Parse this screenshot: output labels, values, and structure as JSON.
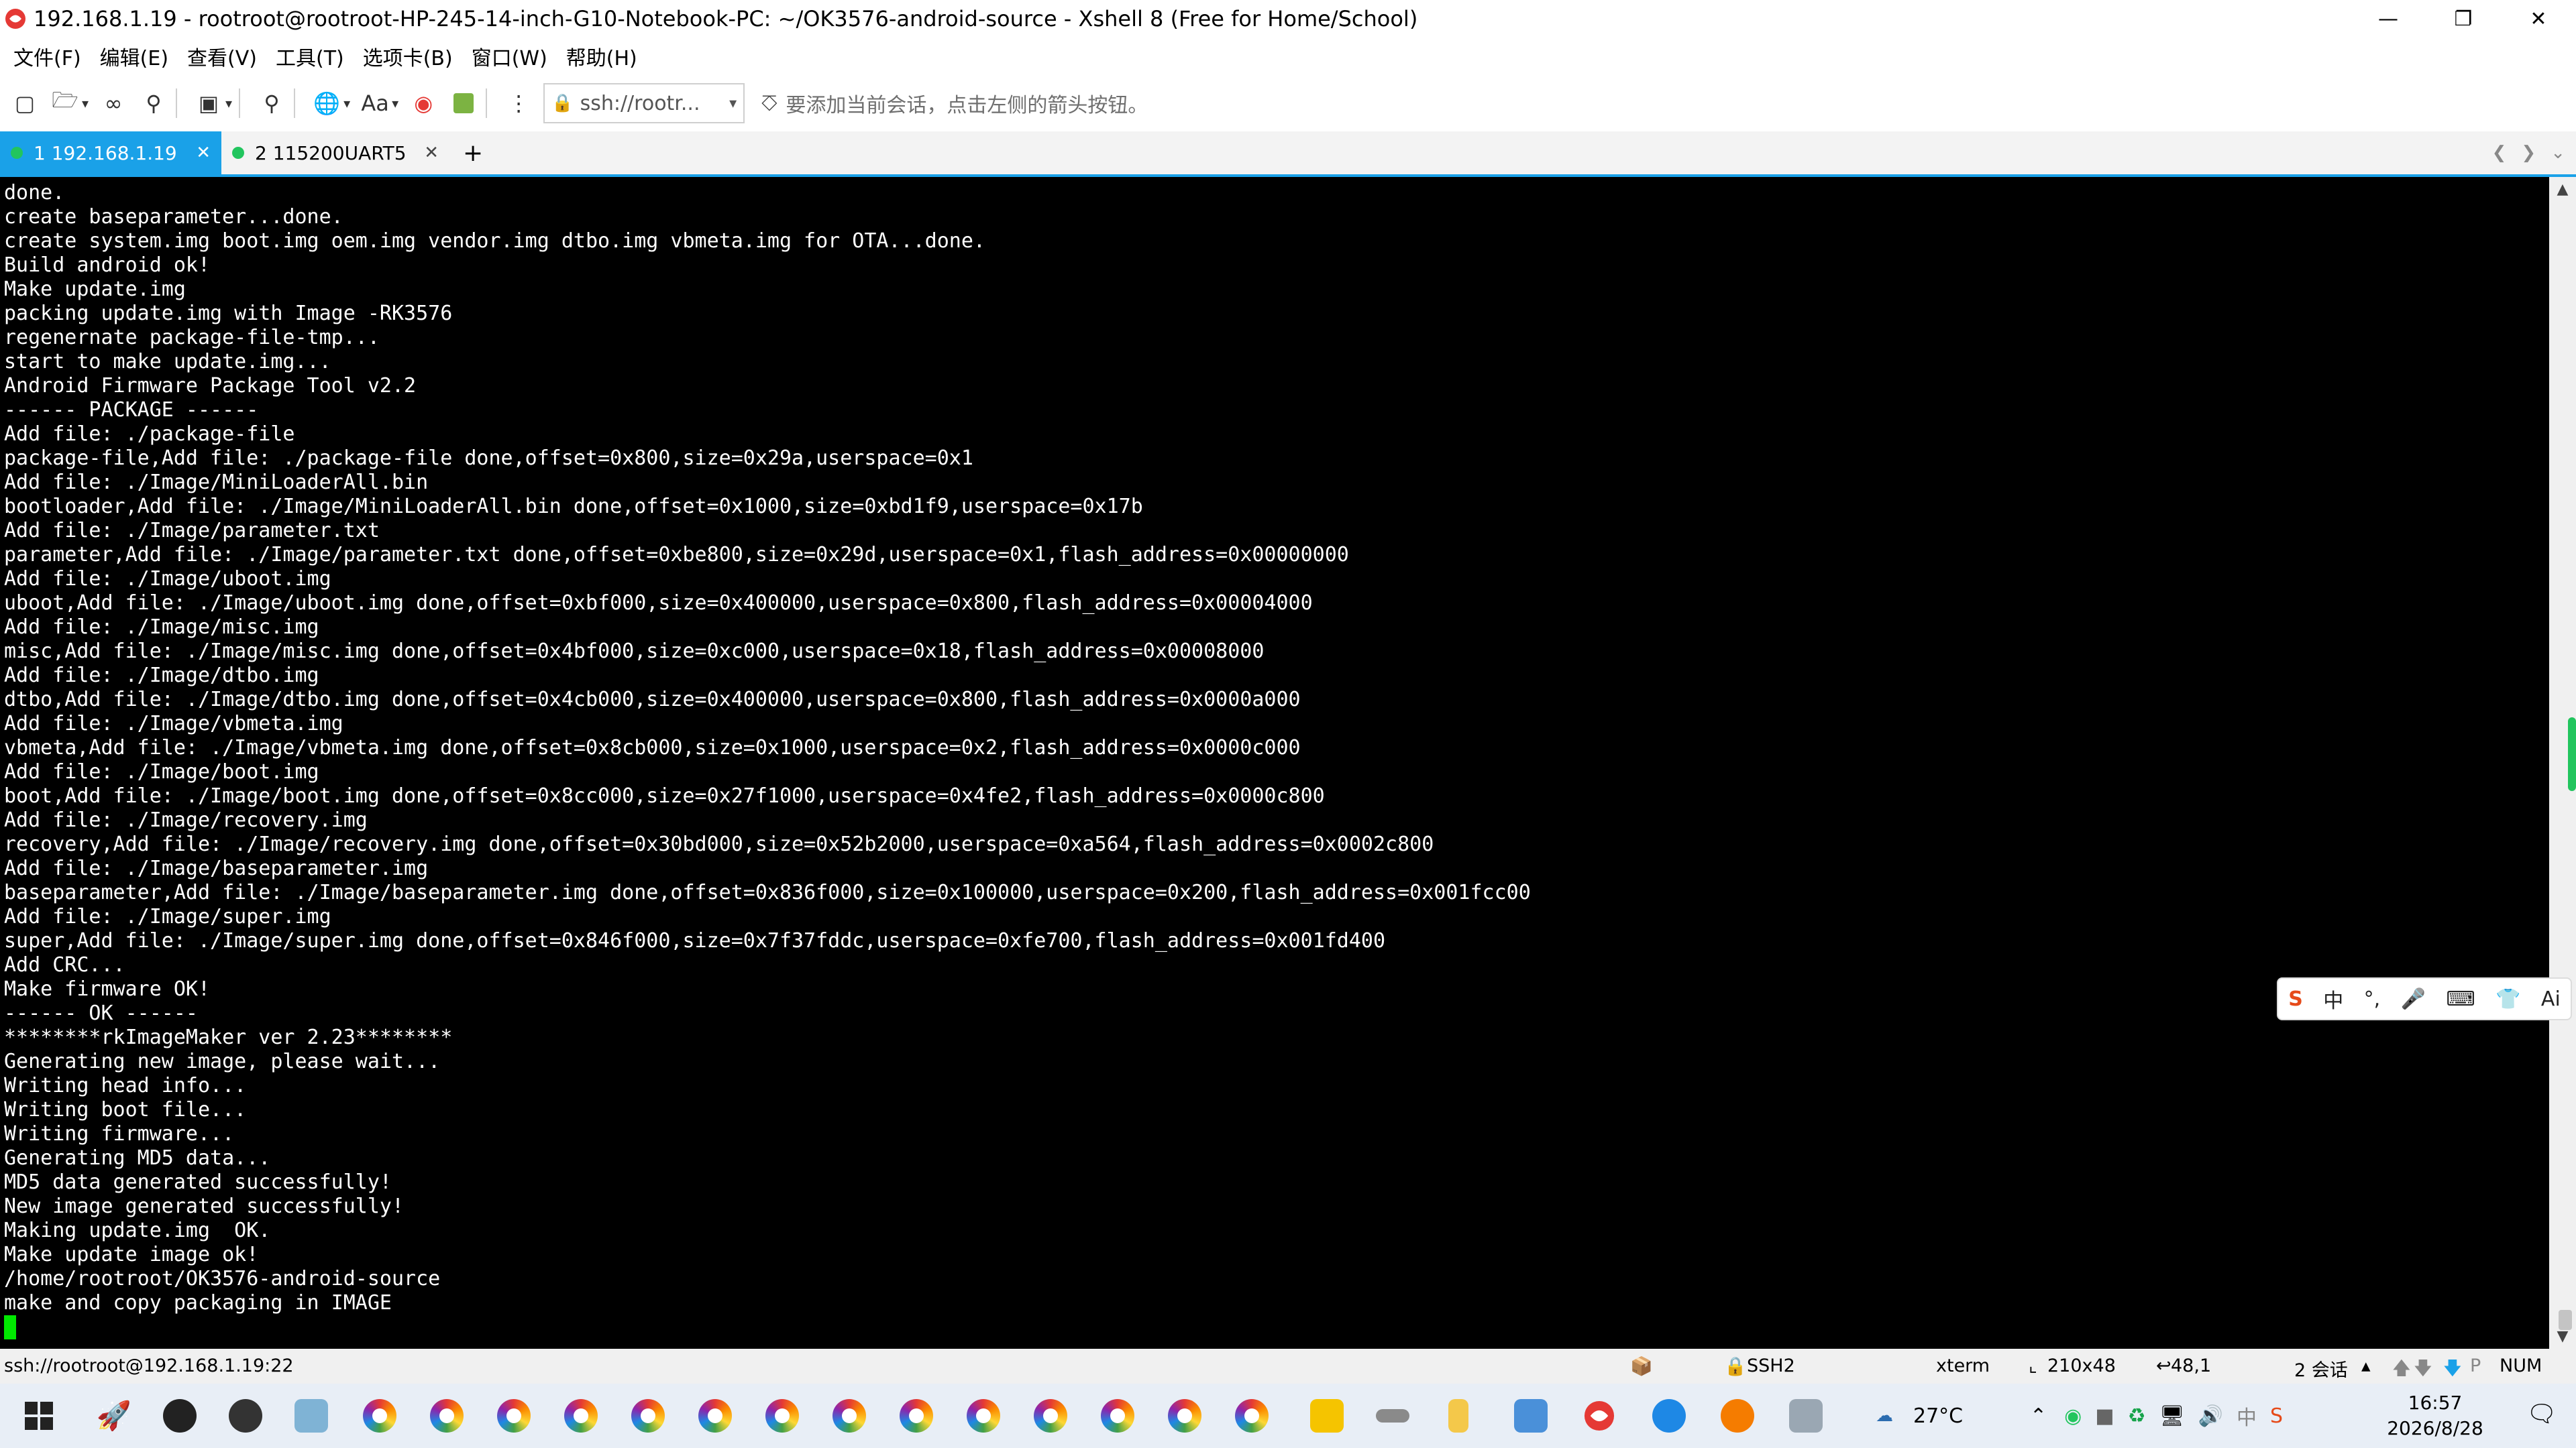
{
  "window": {
    "title": "192.168.1.19 - rootroot@rootroot-HP-245-14-inch-G10-Notebook-PC: ~/OK3576-android-source - Xshell 8 (Free for Home/School)"
  },
  "menu": [
    "文件(F)",
    "编辑(E)",
    "查看(V)",
    "工具(T)",
    "选项卡(B)",
    "窗口(W)",
    "帮助(H)"
  ],
  "toolbar": {
    "address_value": "ssh://rootr...",
    "font_label": "Aa",
    "session_hint": "要添加当前会话，点击左侧的箭头按钮。"
  },
  "tabs": [
    {
      "label": "1 192.168.1.19",
      "active": true
    },
    {
      "label": "2 115200UART5",
      "active": false
    }
  ],
  "terminal": {
    "lines": [
      "done.",
      "create baseparameter...done.",
      "create system.img boot.img oem.img vendor.img dtbo.img vbmeta.img for OTA...done.",
      "Build android ok!",
      "Make update.img",
      "packing update.img with Image -RK3576",
      "regenernate package-file-tmp...",
      "start to make update.img...",
      "Android Firmware Package Tool v2.2",
      "------ PACKAGE ------",
      "Add file: ./package-file",
      "package-file,Add file: ./package-file done,offset=0x800,size=0x29a,userspace=0x1",
      "Add file: ./Image/MiniLoaderAll.bin",
      "bootloader,Add file: ./Image/MiniLoaderAll.bin done,offset=0x1000,size=0xbd1f9,userspace=0x17b",
      "Add file: ./Image/parameter.txt",
      "parameter,Add file: ./Image/parameter.txt done,offset=0xbe800,size=0x29d,userspace=0x1,flash_address=0x00000000",
      "Add file: ./Image/uboot.img",
      "uboot,Add file: ./Image/uboot.img done,offset=0xbf000,size=0x400000,userspace=0x800,flash_address=0x00004000",
      "Add file: ./Image/misc.img",
      "misc,Add file: ./Image/misc.img done,offset=0x4bf000,size=0xc000,userspace=0x18,flash_address=0x00008000",
      "Add file: ./Image/dtbo.img",
      "dtbo,Add file: ./Image/dtbo.img done,offset=0x4cb000,size=0x400000,userspace=0x800,flash_address=0x0000a000",
      "Add file: ./Image/vbmeta.img",
      "vbmeta,Add file: ./Image/vbmeta.img done,offset=0x8cb000,size=0x1000,userspace=0x2,flash_address=0x0000c000",
      "Add file: ./Image/boot.img",
      "boot,Add file: ./Image/boot.img done,offset=0x8cc000,size=0x27f1000,userspace=0x4fe2,flash_address=0x0000c800",
      "Add file: ./Image/recovery.img",
      "recovery,Add file: ./Image/recovery.img done,offset=0x30bd000,size=0x52b2000,userspace=0xa564,flash_address=0x0002c800",
      "Add file: ./Image/baseparameter.img",
      "baseparameter,Add file: ./Image/baseparameter.img done,offset=0x836f000,size=0x100000,userspace=0x200,flash_address=0x001fcc00",
      "Add file: ./Image/super.img",
      "super,Add file: ./Image/super.img done,offset=0x846f000,size=0x7f37fddc,userspace=0xfe700,flash_address=0x001fd400",
      "Add CRC...",
      "Make firmware OK!",
      "------ OK ------",
      "********rkImageMaker ver 2.23********",
      "Generating new image, please wait...",
      "Writing head info...",
      "Writing boot file...",
      "Writing firmware...",
      "Generating MD5 data...",
      "MD5 data generated successfully!",
      "New image generated successfully!",
      "Making update.img  OK.",
      "Make update image ok!",
      "/home/rootroot/OK3576-android-source",
      "make and copy packaging in IMAGE"
    ]
  },
  "statusbar": {
    "connection": "ssh://rootroot@192.168.1.19:22",
    "protocol": "SSH2",
    "terminal_type": "xterm",
    "size": "210x48",
    "cursor_pos": "48,1",
    "sessions": "2 会话",
    "num": "NUM"
  },
  "taskbar": {
    "temperature": "27°C",
    "ime_lang": "中",
    "time": "16:57",
    "date": "2026/8/28"
  },
  "ime_bar": {
    "lang": "中",
    "ai": "Ai"
  },
  "colors": {
    "accent": "#1aa1e8",
    "terminal_bg": "#000000",
    "cursor": "#00e800",
    "status_dot": "#22c55e"
  }
}
